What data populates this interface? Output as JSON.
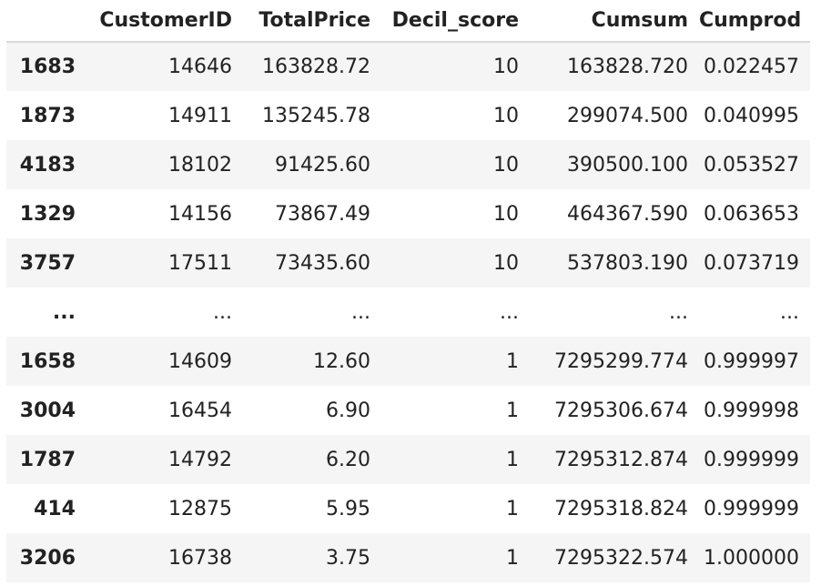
{
  "table": {
    "columns": [
      "",
      "CustomerID",
      "TotalPrice",
      "Decil_score",
      "Cumsum",
      "Cumprod"
    ],
    "rows": [
      {
        "index": "1683",
        "cells": [
          "14646",
          "163828.72",
          "10",
          "163828.720",
          "0.022457"
        ]
      },
      {
        "index": "1873",
        "cells": [
          "14911",
          "135245.78",
          "10",
          "299074.500",
          "0.040995"
        ]
      },
      {
        "index": "4183",
        "cells": [
          "18102",
          "91425.60",
          "10",
          "390500.100",
          "0.053527"
        ]
      },
      {
        "index": "1329",
        "cells": [
          "14156",
          "73867.49",
          "10",
          "464367.590",
          "0.063653"
        ]
      },
      {
        "index": "3757",
        "cells": [
          "17511",
          "73435.60",
          "10",
          "537803.190",
          "0.073719"
        ]
      },
      {
        "index": "...",
        "cells": [
          "...",
          "...",
          "...",
          "...",
          "..."
        ]
      },
      {
        "index": "1658",
        "cells": [
          "14609",
          "12.60",
          "1",
          "7295299.774",
          "0.999997"
        ]
      },
      {
        "index": "3004",
        "cells": [
          "16454",
          "6.90",
          "1",
          "7295306.674",
          "0.999998"
        ]
      },
      {
        "index": "1787",
        "cells": [
          "14792",
          "6.20",
          "1",
          "7295312.874",
          "0.999999"
        ]
      },
      {
        "index": "414",
        "cells": [
          "12875",
          "5.95",
          "1",
          "7295318.824",
          "0.999999"
        ]
      },
      {
        "index": "3206",
        "cells": [
          "16738",
          "3.75",
          "1",
          "7295322.574",
          "1.000000"
        ]
      }
    ]
  }
}
